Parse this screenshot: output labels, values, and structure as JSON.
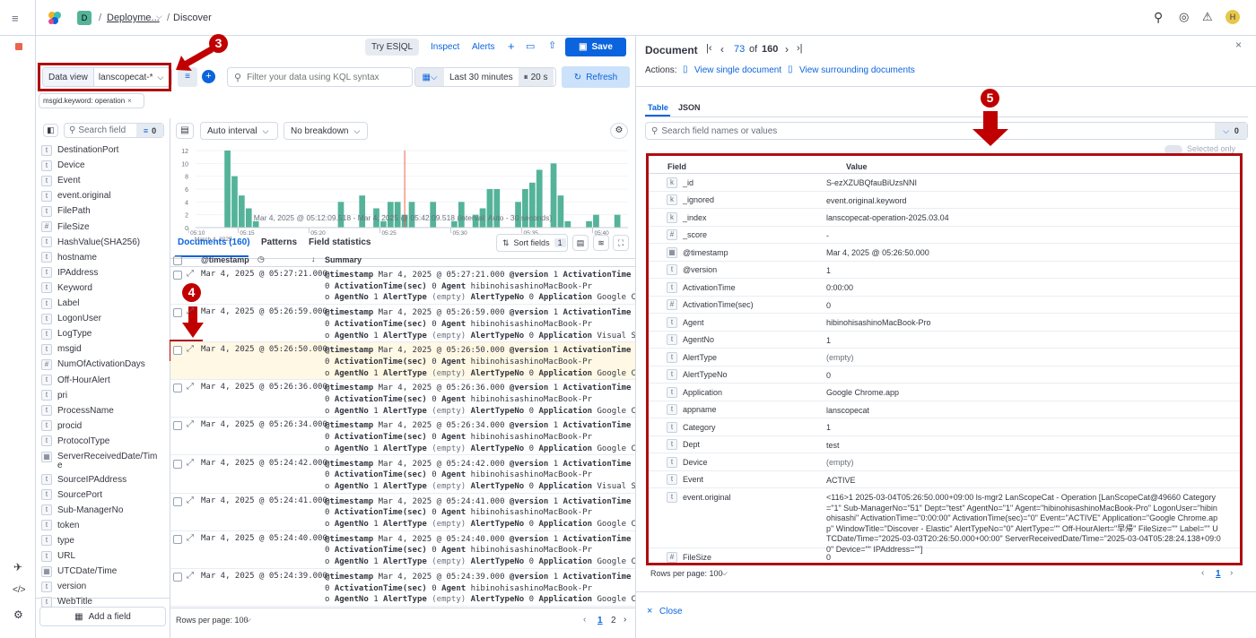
{
  "topbar": {
    "space_letter": "D",
    "breadcrumb_deploy": "Deployme...",
    "breadcrumb_sep": "/",
    "breadcrumb_page": "Discover",
    "user_initial": "H"
  },
  "toolbar": {
    "try_esql": "Try ES|QL",
    "inspect": "Inspect",
    "alerts": "Alerts",
    "save": "Save"
  },
  "query": {
    "data_view_label": "Data view",
    "data_view_value": "lanscopecat-*",
    "search_placeholder": "Filter your data using KQL syntax",
    "time_range": "Last 30 minutes",
    "refresh_interval": "20 s",
    "refresh_label": "Refresh",
    "filter_pill": "msgid.keyword: operation"
  },
  "sidebar": {
    "search_placeholder": "Search field",
    "filter_count": "0",
    "add_field": "Add a field",
    "fields": [
      {
        "type": "t",
        "name": "DestinationPort"
      },
      {
        "type": "t",
        "name": "Device"
      },
      {
        "type": "t",
        "name": "Event"
      },
      {
        "type": "t",
        "name": "event.original"
      },
      {
        "type": "t",
        "name": "FilePath"
      },
      {
        "type": "#",
        "name": "FileSize"
      },
      {
        "type": "t",
        "name": "HashValue(SHA256)"
      },
      {
        "type": "t",
        "name": "hostname"
      },
      {
        "type": "t",
        "name": "IPAddress"
      },
      {
        "type": "t",
        "name": "Keyword"
      },
      {
        "type": "t",
        "name": "Label"
      },
      {
        "type": "t",
        "name": "LogonUser"
      },
      {
        "type": "t",
        "name": "LogType"
      },
      {
        "type": "t",
        "name": "msgid"
      },
      {
        "type": "#",
        "name": "NumOfActivationDays"
      },
      {
        "type": "t",
        "name": "Off-HourAlert"
      },
      {
        "type": "t",
        "name": "pri"
      },
      {
        "type": "t",
        "name": "ProcessName"
      },
      {
        "type": "t",
        "name": "procid"
      },
      {
        "type": "t",
        "name": "ProtocolType"
      },
      {
        "type": "d",
        "name": "ServerReceivedDate/Tim"
      },
      {
        "type": "t",
        "name": "SourceIPAddress"
      },
      {
        "type": "t",
        "name": "SourcePort"
      },
      {
        "type": "t",
        "name": "Sub-ManagerNo"
      },
      {
        "type": "t",
        "name": "token"
      },
      {
        "type": "t",
        "name": "type"
      },
      {
        "type": "t",
        "name": "URL"
      },
      {
        "type": "d",
        "name": "UTCDate/Time"
      },
      {
        "type": "t",
        "name": "version"
      },
      {
        "type": "t",
        "name": "WebTitle"
      }
    ],
    "field_wrap_tail": "e"
  },
  "histogram": {
    "interval": "Auto interval",
    "breakdown": "No breakdown",
    "y_ticks": [
      "12",
      "10",
      "8",
      "6",
      "4",
      "2",
      "0"
    ],
    "x_ticks": [
      "05:10",
      "05:15",
      "05:20",
      "05:25",
      "05:30",
      "05:35",
      "05:40"
    ],
    "x_date": "March 4, 2025",
    "caption": "Mar 4, 2025 @ 05:12:09.518 - Mar 4, 2025 @ 05:42:09.518 (interval: Auto - 30 seconds)"
  },
  "chart_data": {
    "type": "bar",
    "title": "",
    "xlabel": "",
    "ylabel": "",
    "ylim": [
      0,
      12
    ],
    "categories": [
      "05:12:00",
      "05:12:30",
      "05:13:00",
      "05:13:30",
      "05:14:00",
      "05:14:30",
      "05:15:00",
      "05:15:30",
      "05:16:00",
      "05:16:30",
      "05:17:00",
      "05:17:30",
      "05:18:00",
      "05:18:30",
      "05:19:00",
      "05:19:30",
      "05:20:00",
      "05:20:30",
      "05:21:00",
      "05:21:30",
      "05:22:00",
      "05:22:30",
      "05:23:00",
      "05:23:30",
      "05:24:00",
      "05:24:30",
      "05:25:00",
      "05:25:30",
      "05:26:00",
      "05:26:30",
      "05:27:00",
      "05:27:30",
      "05:28:00",
      "05:28:30",
      "05:29:00",
      "05:29:30",
      "05:30:00",
      "05:30:30",
      "05:31:00",
      "05:31:30",
      "05:32:00",
      "05:32:30",
      "05:33:00",
      "05:33:30",
      "05:34:00",
      "05:34:30",
      "05:35:00",
      "05:35:30",
      "05:36:00",
      "05:36:30",
      "05:37:00",
      "05:37:30",
      "05:38:00",
      "05:38:30",
      "05:39:00",
      "05:39:30",
      "05:40:00",
      "05:40:30",
      "05:41:00",
      "05:41:30",
      "05:42:00"
    ],
    "values": [
      0,
      0,
      0,
      0,
      12,
      8,
      5,
      3,
      1,
      0,
      0,
      0,
      0,
      0,
      0,
      0,
      0,
      0,
      0,
      0,
      4,
      0,
      0,
      5,
      0,
      3,
      1,
      4,
      4,
      2,
      4,
      0,
      0,
      4,
      0,
      0,
      1,
      4,
      0,
      2,
      3,
      6,
      6,
      0,
      0,
      4,
      6,
      7,
      9,
      0,
      10,
      5,
      1,
      0,
      0,
      1,
      2,
      0,
      0,
      2,
      0
    ],
    "marker": "05:26:30"
  },
  "tabs": {
    "documents": "Documents (160)",
    "patterns": "Patterns",
    "field_statistics": "Field statistics",
    "sort_fields": "Sort fields",
    "sort_count": "1"
  },
  "doc_table": {
    "col_timestamp": "@timestamp",
    "col_summary": "Summary",
    "rows": [
      {
        "ts": "Mar 4, 2025 @ 05:27:21.000",
        "l1": "Mar 4, 2025 @ 05:27:21.000",
        "app": "Google Chrome.a..."
      },
      {
        "ts": "Mar 4, 2025 @ 05:26:59.000",
        "l1": "Mar 4, 2025 @ 05:26:59.000",
        "app": "Visual Studio C..."
      },
      {
        "ts": "Mar 4, 2025 @ 05:26:50.000",
        "l1": "Mar 4, 2025 @ 05:26:50.000",
        "app": "Google Chrome.a..."
      },
      {
        "ts": "Mar 4, 2025 @ 05:26:36.000",
        "l1": "Mar 4, 2025 @ 05:26:36.000",
        "app": "Google Chrome.a..."
      },
      {
        "ts": "Mar 4, 2025 @ 05:26:34.000",
        "l1": "Mar 4, 2025 @ 05:26:34.000",
        "app": "Google Chrome.a..."
      },
      {
        "ts": "Mar 4, 2025 @ 05:24:42.000",
        "l1": "Mar 4, 2025 @ 05:24:42.000",
        "app": "Visual Studio C..."
      },
      {
        "ts": "Mar 4, 2025 @ 05:24:41.000",
        "l1": "Mar 4, 2025 @ 05:24:41.000",
        "app": "Google Chrome.a..."
      },
      {
        "ts": "Mar 4, 2025 @ 05:24:40.000",
        "l1": "Mar 4, 2025 @ 05:24:40.000",
        "app": "Google Chrome.a..."
      },
      {
        "ts": "Mar 4, 2025 @ 05:24:39.000",
        "l1": "Mar 4, 2025 @ 05:24:39.000",
        "app": "Google Chrome.a..."
      }
    ],
    "k_timestamp": "@timestamp",
    "k_version": "@version",
    "v_version": "1",
    "k_activation": "ActivationTime",
    "v_activation": "0:00:0",
    "v_activation_cont": "0",
    "k_activation_sec": "ActivationTime(sec)",
    "v_activation_sec": "0",
    "k_agent": "Agent",
    "v_agent": "hibinohisashinoMacBook-Pr",
    "v_agent_cont": "o",
    "k_agentno": "AgentNo",
    "v_agentno": "1",
    "k_alerttype": "AlertType",
    "v_alerttype": "(empty)",
    "k_alerttypeno": "AlertTypeNo",
    "v_alerttypeno": "0",
    "k_application": "Application",
    "rows_per_page": "Rows per page: 100",
    "page_1": "1",
    "page_2": "2"
  },
  "flyout": {
    "title": "Document",
    "current": "73",
    "of": "of",
    "total": "160",
    "actions_label": "Actions:",
    "view_single": "View single document",
    "view_surrounding": "View surrounding documents",
    "tab_table": "Table",
    "tab_json": "JSON",
    "search_placeholder": "Search field names or values",
    "filter_count": "0",
    "selected_only": "Selected only",
    "col_field": "Field",
    "col_value": "Value",
    "rows": [
      {
        "t": "k",
        "f": "_id",
        "v": "S-ezXZUBQfauBiUzsNNI"
      },
      {
        "t": "k",
        "f": "_ignored",
        "v": "event.original.keyword"
      },
      {
        "t": "k",
        "f": "_index",
        "v": "lanscopecat-operation-2025.03.04"
      },
      {
        "t": "#",
        "f": "_score",
        "v": "-"
      },
      {
        "t": "d",
        "f": "@timestamp",
        "v": "Mar 4, 2025 @ 05:26:50.000"
      },
      {
        "t": "t",
        "f": "@version",
        "v": "1"
      },
      {
        "t": "t",
        "f": "ActivationTime",
        "v": "0:00:00"
      },
      {
        "t": "#",
        "f": "ActivationTime(sec)",
        "v": "0"
      },
      {
        "t": "t",
        "f": "Agent",
        "v": "hibinohisashinoMacBook-Pro"
      },
      {
        "t": "t",
        "f": "AgentNo",
        "v": "1"
      },
      {
        "t": "t",
        "f": "AlertType",
        "v": "(empty)"
      },
      {
        "t": "t",
        "f": "AlertTypeNo",
        "v": "0"
      },
      {
        "t": "t",
        "f": "Application",
        "v": "Google Chrome.app"
      },
      {
        "t": "t",
        "f": "appname",
        "v": "lanscopecat"
      },
      {
        "t": "t",
        "f": "Category",
        "v": "1"
      },
      {
        "t": "t",
        "f": "Dept",
        "v": "test"
      },
      {
        "t": "t",
        "f": "Device",
        "v": "(empty)"
      },
      {
        "t": "t",
        "f": "Event",
        "v": "ACTIVE"
      },
      {
        "t": "t",
        "f": "event.original",
        "v": "<116>1 2025-03-04T05:26:50.000+09:00 ls-mgr2 LanScopeCat - Operation [LanScopeCat@49660 Category=\"1\" Sub-ManagerNo=\"51\" Dept=\"test\" AgentNo=\"1\" Agent=\"hibinohisashinoMacBook-Pro\" LogonUser=\"hibinohisashi\" ActivationTime=\"0:00:00\" ActivationTime(sec)=\"0\" Event=\"ACTIVE\" Application=\"Google Chrome.app\" WindowTitle=\"Discover - Elastic\" AlertTypeNo=\"0\" AlertType=\"\" Off-HourAlert=\"早帰\" FileSize=\"\" Label=\"\" UTCDate/Time=\"2025-03-03T20:26:50.000+00:00\" ServerReceivedDate/Time=\"2025-03-04T05:28:24.138+09:00\" Device=\"\" IPAddress=\"\"]"
      },
      {
        "t": "#",
        "f": "FileSize",
        "v": "0"
      }
    ],
    "rows_per_page": "Rows per page: 100",
    "page": "1",
    "close": "Close"
  },
  "annotations": {
    "n3": "3",
    "n4": "4",
    "n5": "5"
  },
  "colors": {
    "accent": "#0b64dd",
    "bar": "#54b399",
    "annotation_red": "#b00d10"
  }
}
